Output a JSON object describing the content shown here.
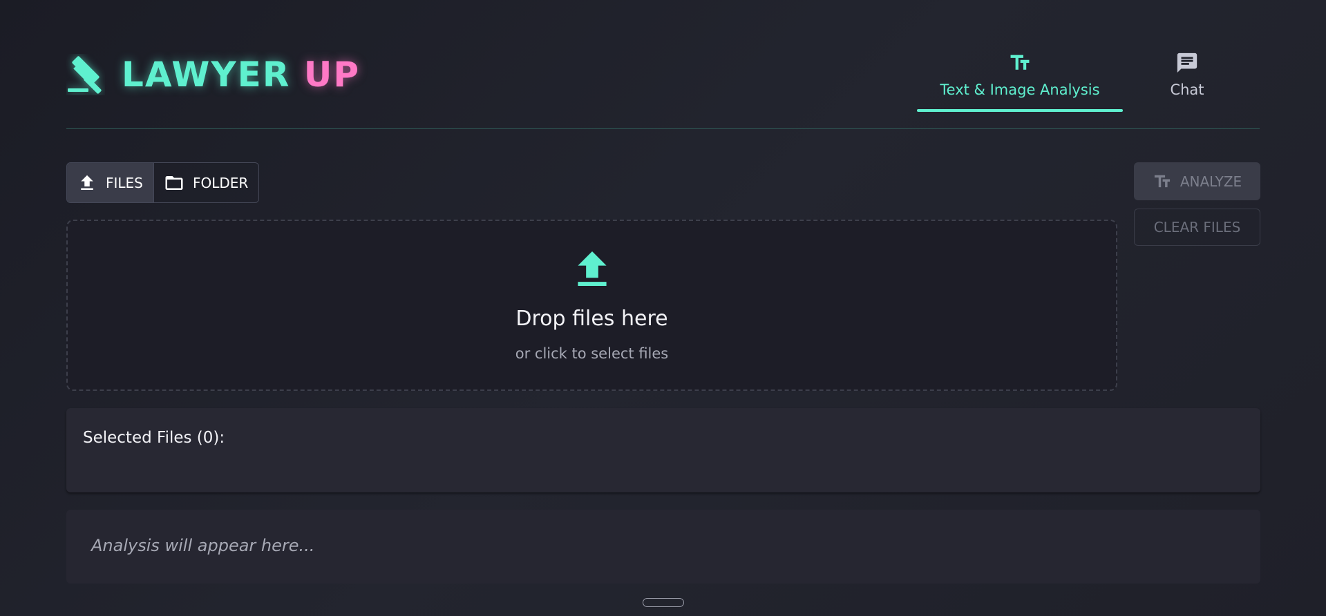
{
  "brand": {
    "name_part1": "LAWYER",
    "name_part2": "UP"
  },
  "colors": {
    "accent": "#5ff0cf",
    "brand_pink": "#ff79c6",
    "background": "#1f2029"
  },
  "nav": {
    "tabs": [
      {
        "label": "Text & Image Analysis",
        "icon": "text-format-icon",
        "active": true
      },
      {
        "label": "Chat",
        "icon": "chat-icon",
        "active": false
      }
    ]
  },
  "upload": {
    "files_label": "FILES",
    "folder_label": "FOLDER"
  },
  "actions": {
    "analyze_label": "ANALYZE",
    "clear_label": "CLEAR FILES"
  },
  "dropzone": {
    "title": "Drop files here",
    "subtitle": "or click to select files"
  },
  "selected_files": {
    "title": "Selected Files (0):",
    "count": 0,
    "items": []
  },
  "analysis": {
    "placeholder": "Analysis will appear here..."
  }
}
